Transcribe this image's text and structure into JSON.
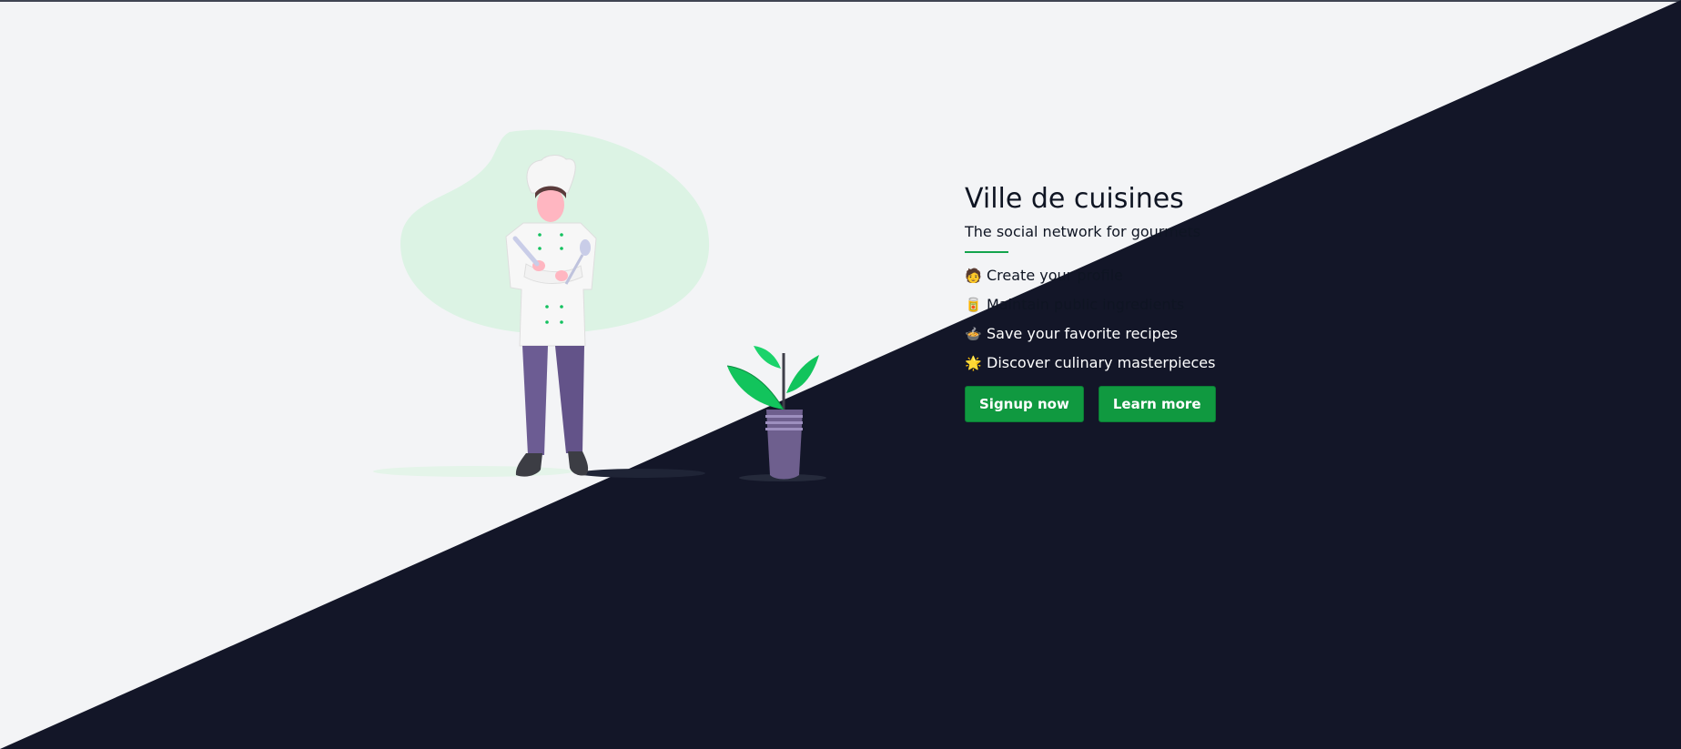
{
  "hero": {
    "title": "Ville de cuisines",
    "subtitle": "The social network for gourmets",
    "features": [
      {
        "emoji": "🧑",
        "text": "Create your profile"
      },
      {
        "emoji": "🥫",
        "text": "Maintain public ingredients"
      },
      {
        "emoji": "🍲",
        "text": "Save your favorite recipes"
      },
      {
        "emoji": "🌟",
        "text": "Discover culinary masterpieces"
      }
    ],
    "buttons": {
      "signup": "Signup now",
      "learn_more": "Learn more"
    }
  },
  "colors": {
    "light_bg": "#f3f4f6",
    "dark_bg": "#131628",
    "accent_green": "#109940"
  }
}
